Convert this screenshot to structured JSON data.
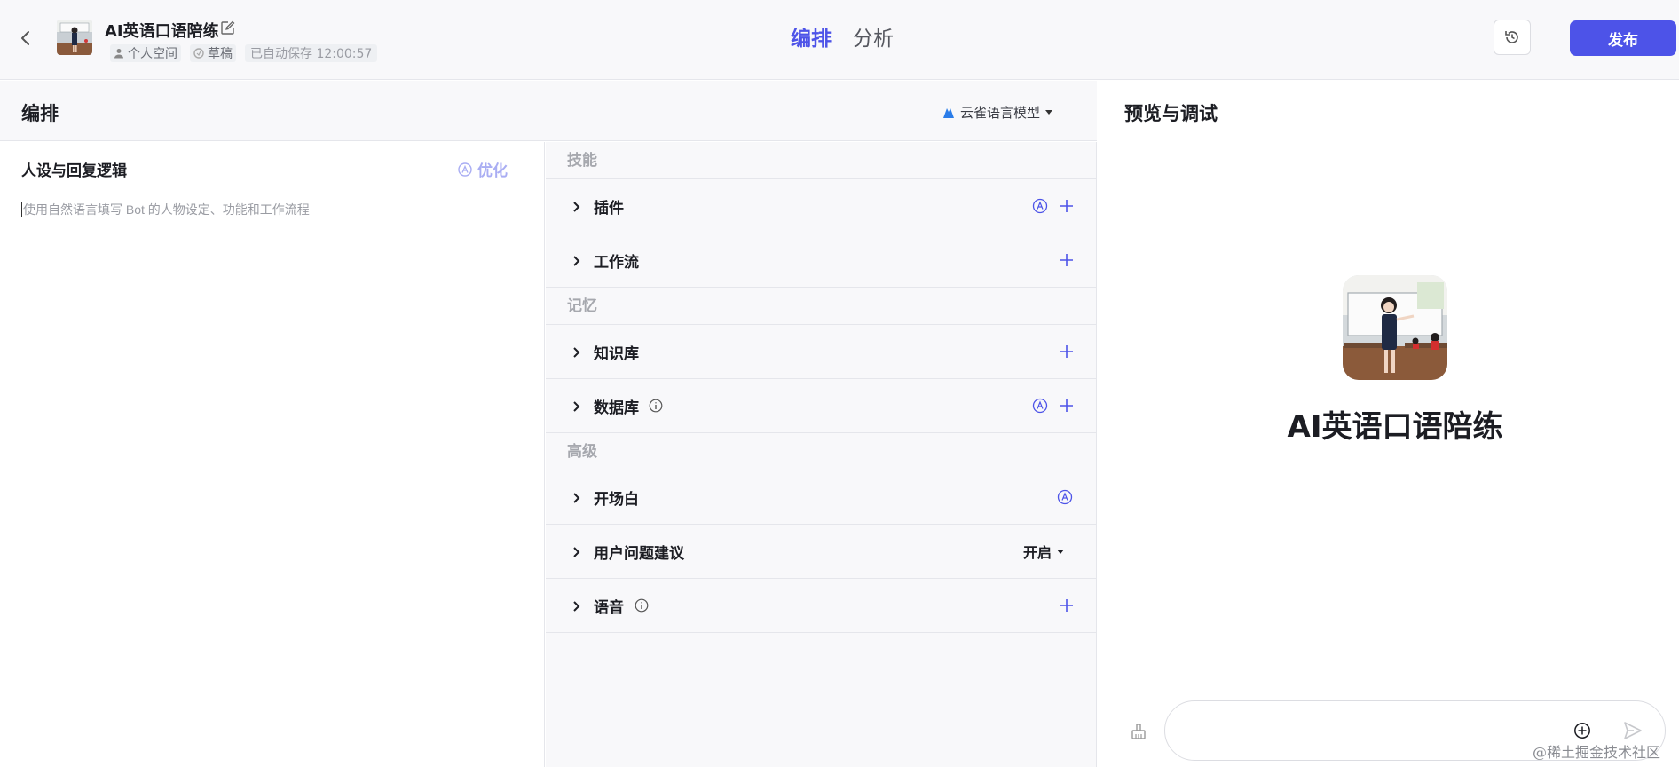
{
  "header": {
    "bot_title": "AI英语口语陪练",
    "meta": {
      "space": "个人空间",
      "status": "草稿",
      "autosave": "已自动保存 12:00:57"
    },
    "tabs": [
      {
        "label": "编排",
        "active": true
      },
      {
        "label": "分析",
        "active": false
      }
    ],
    "publish_label": "发布"
  },
  "orchestration": {
    "title": "编排",
    "model": "云雀语言模型"
  },
  "prompt": {
    "title": "人设与回复逻辑",
    "optimize_label": "优化",
    "placeholder": "使用自然语言填写 Bot 的人物设定、功能和工作流程"
  },
  "skills": {
    "groups": [
      {
        "label": "技能",
        "items": [
          {
            "label": "插件"
          },
          {
            "label": "工作流"
          }
        ]
      },
      {
        "label": "记忆",
        "items": [
          {
            "label": "知识库"
          },
          {
            "label": "数据库"
          }
        ]
      },
      {
        "label": "高级",
        "items": [
          {
            "label": "开场白"
          },
          {
            "label": "用户问题建议",
            "value": "开启"
          },
          {
            "label": "语音"
          }
        ]
      }
    ]
  },
  "preview": {
    "title": "预览与调试",
    "bot_name": "AI英语口语陪练"
  },
  "watermark": "@稀土掘金技术社区",
  "colors": {
    "accent": "#4d53e8",
    "optimize": "#a9adf3",
    "panel_bg": "#f8f8fa",
    "border": "#e5e6eb"
  },
  "icons": [
    "chevron-left-icon",
    "edit-icon",
    "person-icon",
    "draft-icon",
    "history-icon",
    "model-logo-icon",
    "auto-icon",
    "chevron-right-icon",
    "info-icon",
    "plus-icon",
    "broom-icon",
    "plus-circle-icon",
    "send-icon"
  ]
}
